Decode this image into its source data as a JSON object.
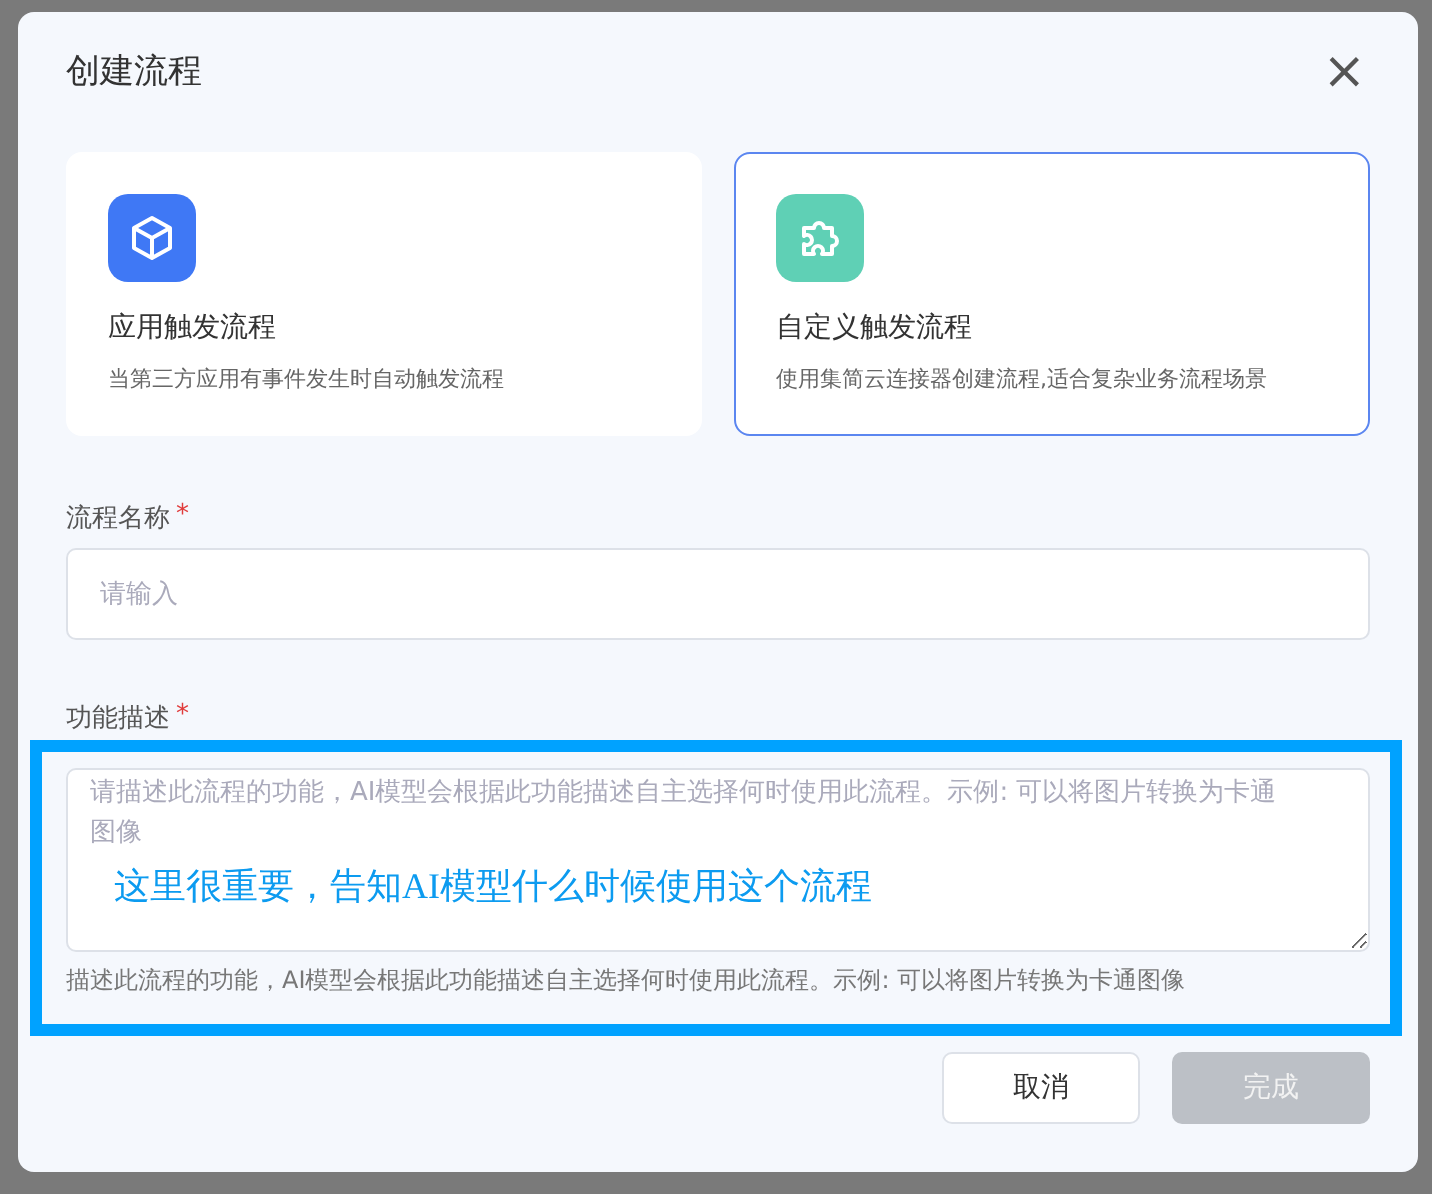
{
  "dialog": {
    "title": "创建流程",
    "close": "×"
  },
  "trigger_options": [
    {
      "kind": "cube",
      "title": "应用触发流程",
      "description": "当第三方应用有事件发生时自动触发流程",
      "selected": false
    },
    {
      "kind": "puzzle",
      "title": "自定义触发流程",
      "description": "使用集简云连接器创建流程,适合复杂业务流程场景",
      "selected": true
    }
  ],
  "name_field": {
    "label": "流程名称",
    "required_mark": "*",
    "placeholder": "请输入"
  },
  "description_field": {
    "label": "功能描述",
    "required_mark": "*",
    "placeholder": "请描述此流程的功能，AI模型会根据此功能描述自主选择何时使用此流程。示例: 可以将图片转换为卡通图像",
    "help": "描述此流程的功能，AI模型会根据此功能描述自主选择何时使用此流程。示例: 可以将图片转换为卡通图像"
  },
  "annotation": {
    "text": "这里很重要，告知AI模型什么时候使用这个流程"
  },
  "buttons": [
    {
      "label": "取消",
      "kind": "secondary",
      "disabled": false
    },
    {
      "label": "完成",
      "kind": "primary",
      "disabled": true
    }
  ]
}
